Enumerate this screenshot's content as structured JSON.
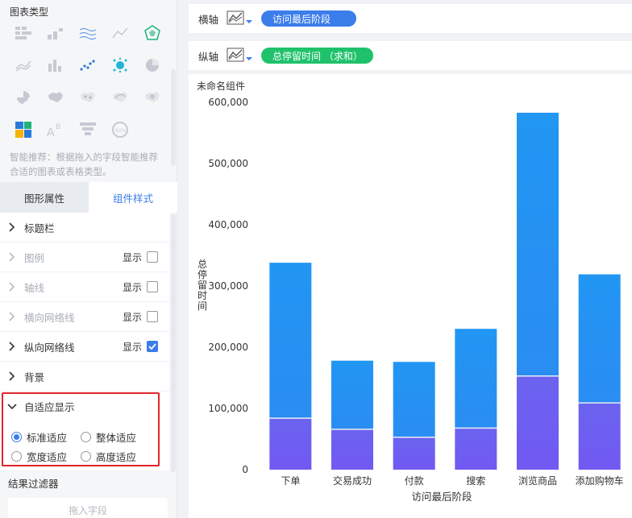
{
  "left_panel": {
    "chart_type_title": "图表类型",
    "hint": "智能推荐：根据拖入的字段智能推荐合适的图表或表格类型。",
    "tabs": [
      {
        "label": "图形属性",
        "active": false
      },
      {
        "label": "组件样式",
        "active": true
      }
    ],
    "show_label": "显示",
    "props": [
      {
        "label": "标题栏",
        "dim": false,
        "has_toggle": false,
        "checked": false
      },
      {
        "label": "图例",
        "dim": true,
        "has_toggle": true,
        "checked": false
      },
      {
        "label": "轴线",
        "dim": true,
        "has_toggle": true,
        "checked": false
      },
      {
        "label": "横向网络线",
        "dim": true,
        "has_toggle": true,
        "checked": false
      },
      {
        "label": "纵向网络线",
        "dim": false,
        "has_toggle": true,
        "checked": true
      },
      {
        "label": "背景",
        "dim": false,
        "has_toggle": false,
        "checked": false
      }
    ],
    "adaptive": {
      "title": "自适应显示",
      "options": [
        {
          "label": "标准适应",
          "selected": true
        },
        {
          "label": "整体适应",
          "selected": false
        },
        {
          "label": "宽度适应",
          "selected": false
        },
        {
          "label": "高度适应",
          "selected": false
        }
      ]
    },
    "filter_title": "结果过滤器",
    "drop_placeholder": "拖入字段"
  },
  "x_axis_bar": {
    "label": "横轴",
    "field": "访问最后阶段"
  },
  "y_axis_bar": {
    "label": "纵轴",
    "field": "总停留时间 （求和）"
  },
  "component_title": "未命名组件",
  "colors": {
    "accent": "#3b7de9",
    "green": "#1fc26b",
    "bar_top": "#2196f3",
    "bar_bottom": "#7159f2",
    "highlight": "#e0242b"
  },
  "chart_data": {
    "type": "bar",
    "stacked": true,
    "categories": [
      "下单",
      "交易成功",
      "付款",
      "搜索",
      "浏览商品",
      "添加购物车"
    ],
    "series": [
      {
        "values": [
          84000,
          66000,
          53000,
          68000,
          153000,
          109000
        ]
      },
      {
        "values": [
          254000,
          112000,
          123000,
          162000,
          430000,
          210000
        ]
      }
    ],
    "xlabel": "访问最后阶段",
    "ylabel": "总停留时间",
    "ylim": [
      0,
      600000
    ],
    "yticks": [
      "0",
      "100,000",
      "200,000",
      "300,000",
      "400,000",
      "500,000",
      "600,000"
    ]
  }
}
